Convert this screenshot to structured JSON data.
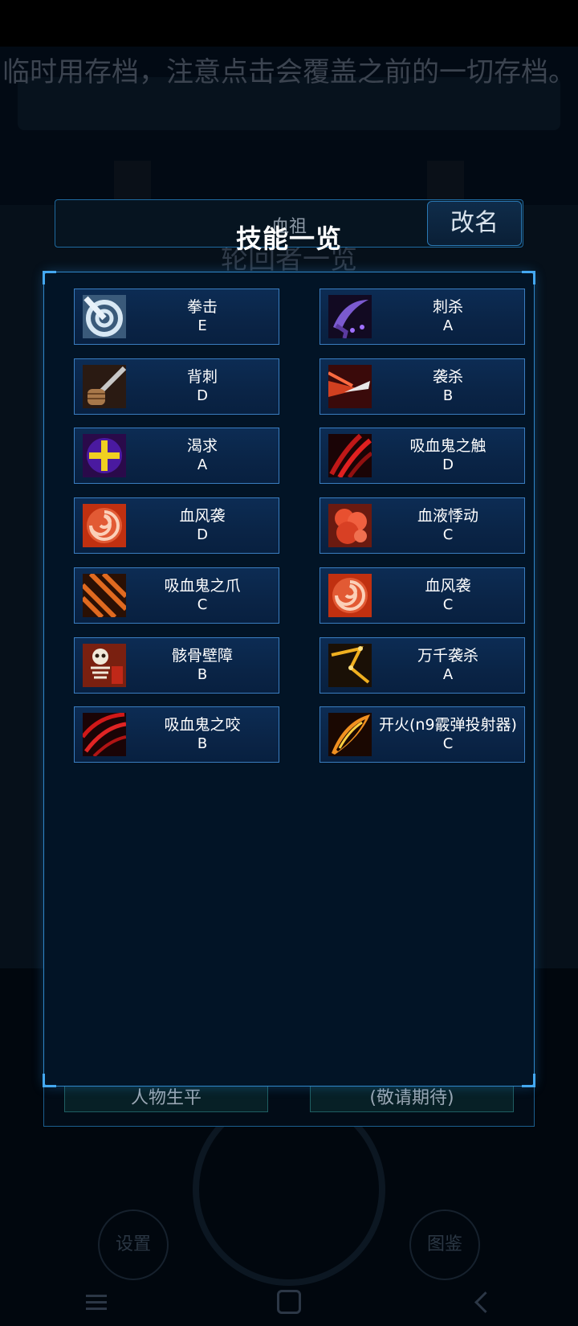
{
  "background": {
    "notice": "临时用存档，注意点击会覆盖之前的一切存档。",
    "section_title": "轮回者一览",
    "bottom_left_button": "人物生平",
    "bottom_right_button": "(敬请期待)",
    "settings_button": "设置",
    "gallery_button": "图鉴"
  },
  "header": {
    "character_name": "血祖",
    "rename_button": "改名",
    "dialog_title": "技能一览"
  },
  "skills": [
    {
      "name": "拳击",
      "grade": "E",
      "icon": "punch-icon"
    },
    {
      "name": "刺杀",
      "grade": "A",
      "icon": "assassinate-icon"
    },
    {
      "name": "背刺",
      "grade": "D",
      "icon": "backstab-icon"
    },
    {
      "name": "袭杀",
      "grade": "B",
      "icon": "ambush-icon"
    },
    {
      "name": "渴求",
      "grade": "A",
      "icon": "craving-icon"
    },
    {
      "name": "吸血鬼之触",
      "grade": "D",
      "icon": "vampire-touch-icon"
    },
    {
      "name": "血风袭",
      "grade": "D",
      "icon": "blood-wind-icon"
    },
    {
      "name": "血液悸动",
      "grade": "C",
      "icon": "blood-pulse-icon"
    },
    {
      "name": "吸血鬼之爪",
      "grade": "C",
      "icon": "vampire-claw-icon"
    },
    {
      "name": "血风袭",
      "grade": "C",
      "icon": "blood-wind-icon"
    },
    {
      "name": "骸骨壁障",
      "grade": "B",
      "icon": "bone-barrier-icon"
    },
    {
      "name": "万千袭杀",
      "grade": "A",
      "icon": "thousand-strikes-icon"
    },
    {
      "name": "吸血鬼之咬",
      "grade": "B",
      "icon": "vampire-bite-icon"
    },
    {
      "name": "开火(n9霰弹投射器)",
      "grade": "C",
      "icon": "fire-shotgun-icon"
    }
  ],
  "colors": {
    "dialog_bg": "#021426",
    "card_border": "#3a7dc0",
    "accent": "#44a8f0"
  }
}
